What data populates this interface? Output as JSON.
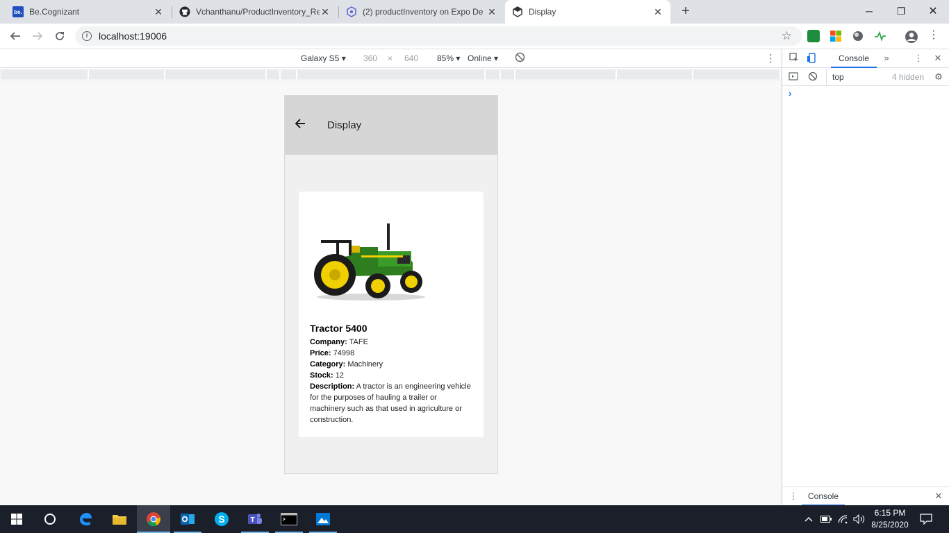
{
  "browser": {
    "tabs": [
      {
        "title": "Be.Cognizant",
        "favicon": "be-logo-icon",
        "active": false
      },
      {
        "title": "Vchanthanu/ProductInventory_Re",
        "favicon": "github-icon",
        "active": false
      },
      {
        "title": "(2) productInventory on Expo De",
        "favicon": "expo-icon",
        "active": false
      },
      {
        "title": "Display",
        "favicon": "expo-icon",
        "active": true
      }
    ],
    "favicon_be_text": "be.",
    "url": "localhost:19006"
  },
  "device_toolbar": {
    "device": "Galaxy S5",
    "width": "360",
    "times": "×",
    "height": "640",
    "zoom": "85%",
    "network": "Online"
  },
  "app": {
    "header_title": "Display",
    "product": {
      "name": "Tractor 5400",
      "company_label": "Company:",
      "company": "TAFE",
      "price_label": "Price:",
      "price": "74998",
      "category_label": "Category:",
      "category": "Machinery",
      "stock_label": "Stock:",
      "stock": "12",
      "description_label": "Description:",
      "description": "A tractor is an engineering vehicle for the purposes of hauling a trailer or machinery such as that used in agriculture or construction."
    }
  },
  "devtools": {
    "tab": "Console",
    "context": "top",
    "hidden_count": "4 hidden",
    "prompt": "›",
    "drawer_tab": "Console"
  },
  "taskbar": {
    "time": "6:15 PM",
    "date": "8/25/2020"
  },
  "colors": {
    "tractor_green": "#2e7d1f",
    "wheel_yellow": "#f0d000",
    "appbar": "#d6d6d6",
    "accent": "#1a73e8"
  }
}
